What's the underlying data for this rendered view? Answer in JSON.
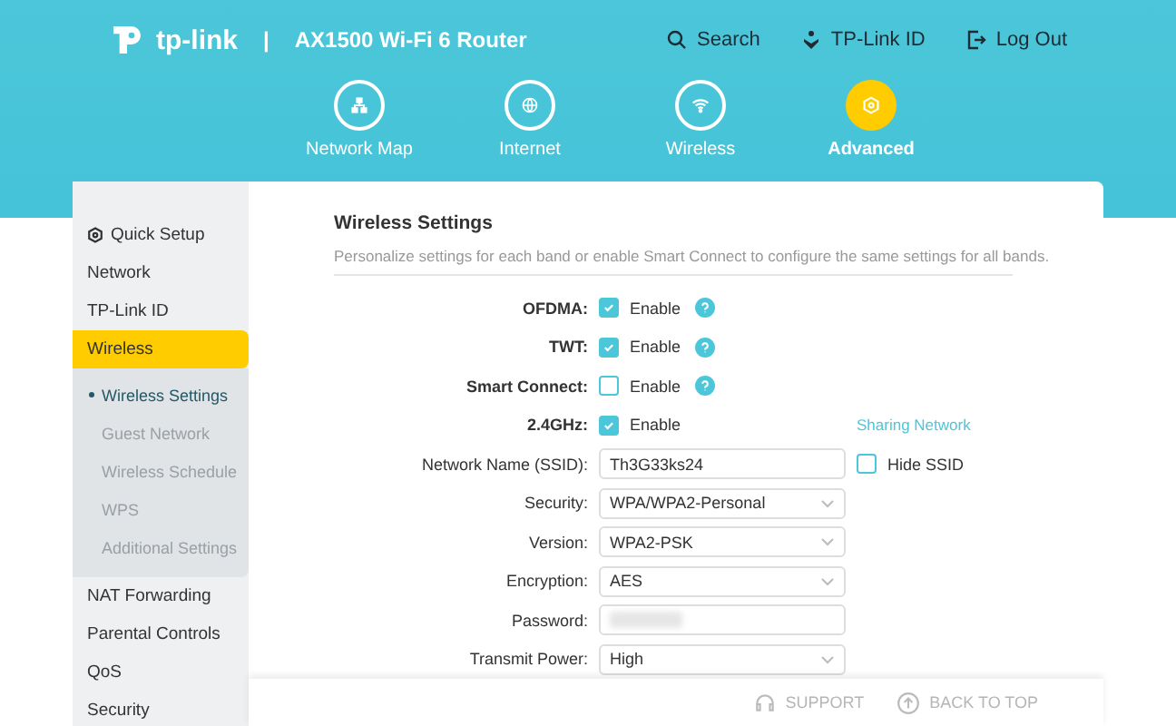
{
  "header": {
    "brand": "tp-link",
    "separator": "|",
    "model": "AX1500 Wi-Fi 6 Router",
    "actions": [
      {
        "kind": "search",
        "label": "Search"
      },
      {
        "kind": "id",
        "label": "TP-Link ID"
      },
      {
        "kind": "logout",
        "label": "Log Out"
      }
    ]
  },
  "nav": [
    {
      "kind": "map",
      "label": "Network Map",
      "selected": false
    },
    {
      "kind": "globe",
      "label": "Internet",
      "selected": false
    },
    {
      "kind": "wifi",
      "label": "Wireless",
      "selected": false
    },
    {
      "kind": "gear",
      "label": "Advanced",
      "selected": true
    }
  ],
  "sidebar": {
    "items": [
      {
        "label": "Quick Setup",
        "kind": "setup",
        "selected": false
      },
      {
        "label": "Network",
        "selected": false
      },
      {
        "label": "TP-Link ID",
        "selected": false
      },
      {
        "label": "Wireless",
        "selected": true,
        "expanded": true,
        "children": [
          {
            "label": "Wireless Settings",
            "selected": true
          },
          {
            "label": "Guest Network",
            "selected": false
          },
          {
            "label": "Wireless Schedule",
            "selected": false
          },
          {
            "label": "WPS",
            "selected": false
          },
          {
            "label": "Additional Settings",
            "selected": false
          }
        ]
      },
      {
        "label": "NAT Forwarding",
        "selected": false
      },
      {
        "label": "Parental Controls",
        "selected": false
      },
      {
        "label": "QoS",
        "selected": false
      },
      {
        "label": "Security",
        "selected": false
      }
    ]
  },
  "section": {
    "title": "Wireless Settings",
    "description": "Personalize settings for each band or enable Smart Connect to configure the same settings for all bands."
  },
  "rows": [
    {
      "kind": "checkbox",
      "label": "OFDMA:",
      "option": "Enable",
      "checked": true,
      "help": true
    },
    {
      "kind": "checkbox",
      "label": "TWT:",
      "option": "Enable",
      "checked": true,
      "help": true
    },
    {
      "kind": "checkbox",
      "label": "Smart Connect:",
      "option": "Enable",
      "checked": false,
      "help": true
    },
    {
      "kind": "checkbox",
      "label": "2.4GHz:",
      "option": "Enable",
      "checked": true,
      "help": false,
      "link": "Sharing Network"
    },
    {
      "kind": "text",
      "label": "Network Name (SSID):",
      "value": "Th3G33ks24",
      "extra": {
        "label": "Hide SSID",
        "checked": false
      }
    },
    {
      "kind": "select",
      "label": "Security:",
      "value": "WPA/WPA2-Personal"
    },
    {
      "kind": "select",
      "label": "Version:",
      "value": "WPA2-PSK"
    },
    {
      "kind": "select",
      "label": "Encryption:",
      "value": "AES"
    },
    {
      "kind": "password",
      "label": "Password:"
    },
    {
      "kind": "select",
      "label": "Transmit Power:",
      "value": "High"
    }
  ],
  "footer": {
    "support": "SUPPORT",
    "back_to_top": "BACK TO TOP"
  }
}
